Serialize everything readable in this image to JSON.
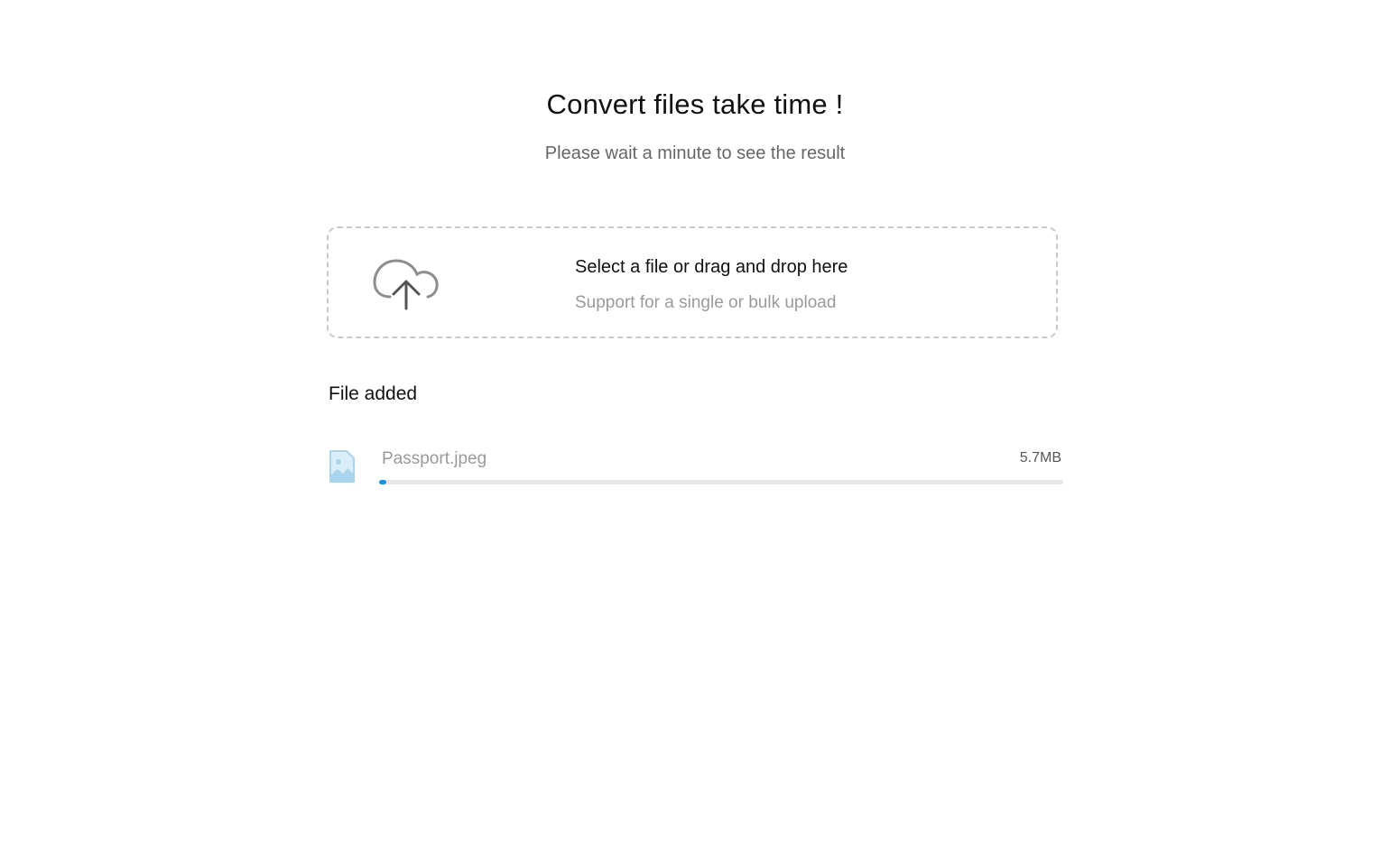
{
  "header": {
    "title": "Convert files take time !",
    "subtitle": "Please wait a minute to see the result"
  },
  "dropzone": {
    "title": "Select a file or drag and drop here",
    "hint": "Support for a single or bulk upload",
    "icon": "cloud-upload-icon"
  },
  "files_section": {
    "label": "File added",
    "files": [
      {
        "name": "Passport.jpeg",
        "size": "5.7MB",
        "icon": "image-file-icon",
        "progress_percent": 1
      }
    ]
  },
  "colors": {
    "accent": "#1a8fe0",
    "file_icon": "#a9d4ec",
    "dropzone_border": "#c9c9c9"
  }
}
